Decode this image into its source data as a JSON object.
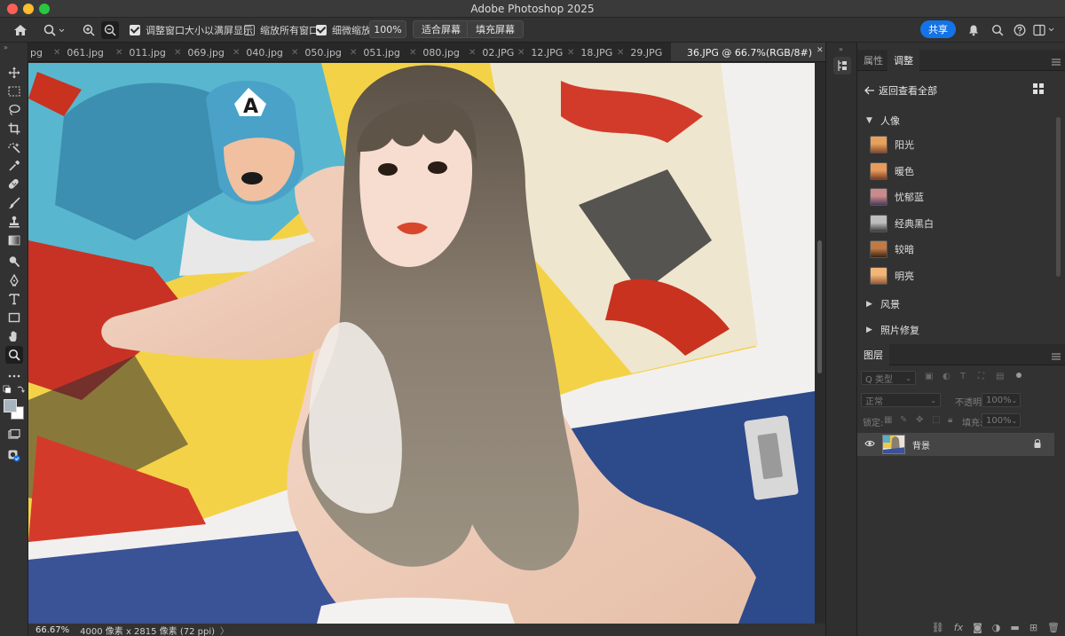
{
  "app": {
    "title": "Adobe Photoshop 2025"
  },
  "options": {
    "resize_windows": "调整窗口大小以满屏显示",
    "zoom_all": "缩放所有窗口",
    "scrubby_zoom": "细微缩放",
    "zoom_value": "100%",
    "fit_screen": "适合屏幕",
    "fill_screen": "填充屏幕",
    "share": "共享"
  },
  "tabs": [
    {
      "label": "pg"
    },
    {
      "label": "061.jpg"
    },
    {
      "label": "011.jpg"
    },
    {
      "label": "069.jpg"
    },
    {
      "label": "040.jpg"
    },
    {
      "label": "050.jpg"
    },
    {
      "label": "051.jpg"
    },
    {
      "label": "080.jpg"
    },
    {
      "label": "02.JPG"
    },
    {
      "label": "12.JPG"
    },
    {
      "label": "18.JPG"
    },
    {
      "label": "29.JPG"
    },
    {
      "label": "36.JPG @ 66.7%(RGB/8#)"
    }
  ],
  "status": {
    "zoom": "66.67%",
    "doc_info": "4000 像素 x 2815 像素 (72 ppi)",
    "arrow": "〉"
  },
  "panels": {
    "properties_tab": "属性",
    "adjustments_tab": "调整",
    "back_label": "返回查看全部",
    "portrait_group": "人像",
    "presets": [
      {
        "label": "阳光",
        "colors": [
          "#e6a15e",
          "#8a4a2a"
        ]
      },
      {
        "label": "暖色",
        "colors": [
          "#e89b5a",
          "#7a3d25"
        ]
      },
      {
        "label": "忧郁蓝",
        "colors": [
          "#c88a8a",
          "#4d3a5c"
        ]
      },
      {
        "label": "经典黑白",
        "colors": [
          "#bdbdbd",
          "#3a3a3a"
        ]
      },
      {
        "label": "较暗",
        "colors": [
          "#c07a45",
          "#3b2416"
        ]
      },
      {
        "label": "明亮",
        "colors": [
          "#f2b478",
          "#9a5a34"
        ]
      }
    ],
    "landscape_group": "风景",
    "photo_repair_group": "照片修复",
    "layers_tab": "图层",
    "layers_filter": "Q 类型",
    "blend_mode": "正常",
    "opacity_label": "不透明度:",
    "opacity_value": "100%",
    "lock_label": "锁定:",
    "fill_label": "填充:",
    "fill_value": "100%",
    "layer_name": "背景"
  }
}
